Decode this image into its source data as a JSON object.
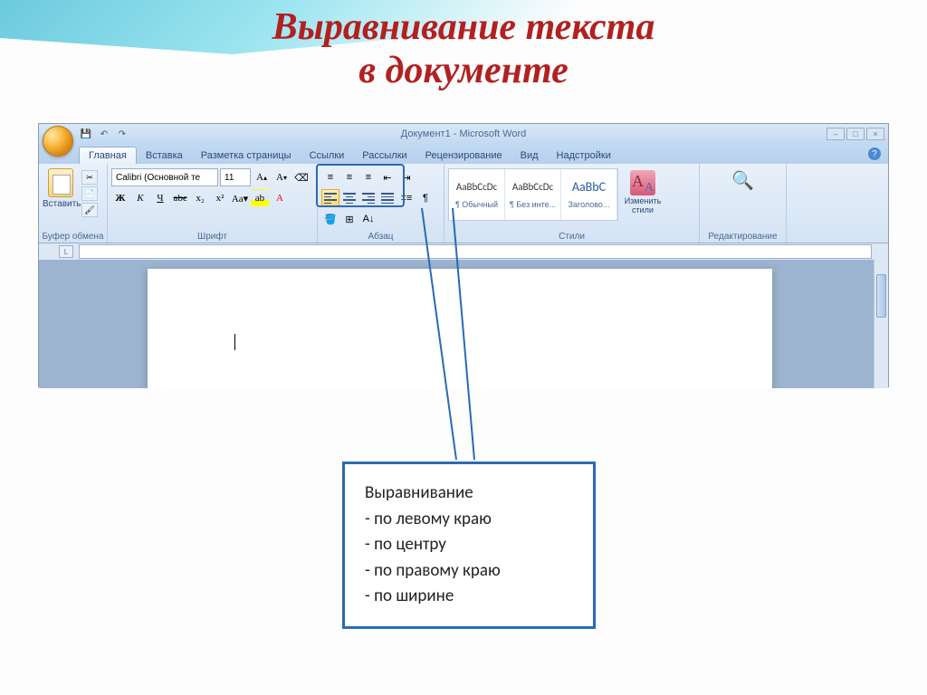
{
  "slide": {
    "title_line1": "Выравнивание текста",
    "title_line2": "в документе"
  },
  "window": {
    "title": "Документ1 - Microsoft Word",
    "qat": {
      "save": "💾",
      "undo": "↶",
      "redo": "↷"
    }
  },
  "tabs": [
    "Главная",
    "Вставка",
    "Разметка страницы",
    "Ссылки",
    "Рассылки",
    "Рецензирование",
    "Вид",
    "Надстройки"
  ],
  "active_tab": 0,
  "ribbon": {
    "clipboard": {
      "label": "Буфер обмена",
      "paste": "Вставить"
    },
    "font": {
      "label": "Шрифт",
      "name": "Calibri (Основной те",
      "size": "11",
      "bold": "Ж",
      "italic": "К",
      "underline": "Ч",
      "strike": "abє",
      "sub": "x₂",
      "sup": "x²",
      "grow": "A▴",
      "shrink": "A▾",
      "clear": "⌫"
    },
    "paragraph": {
      "label": "Абзац"
    },
    "styles": {
      "label": "Стили",
      "items": [
        {
          "sample": "AaBbCcDc",
          "name": "¶ Обычный"
        },
        {
          "sample": "AaBbCcDc",
          "name": "¶ Без инте..."
        },
        {
          "sample": "AaBbC",
          "name": "Заголово..."
        }
      ],
      "change": "Изменить стили"
    },
    "editing": {
      "label": "Редактирование"
    }
  },
  "legend": {
    "title": "Выравнивание",
    "items": [
      "- по левому краю",
      "- по центру",
      "- по правому краю",
      "- по ширине"
    ]
  }
}
